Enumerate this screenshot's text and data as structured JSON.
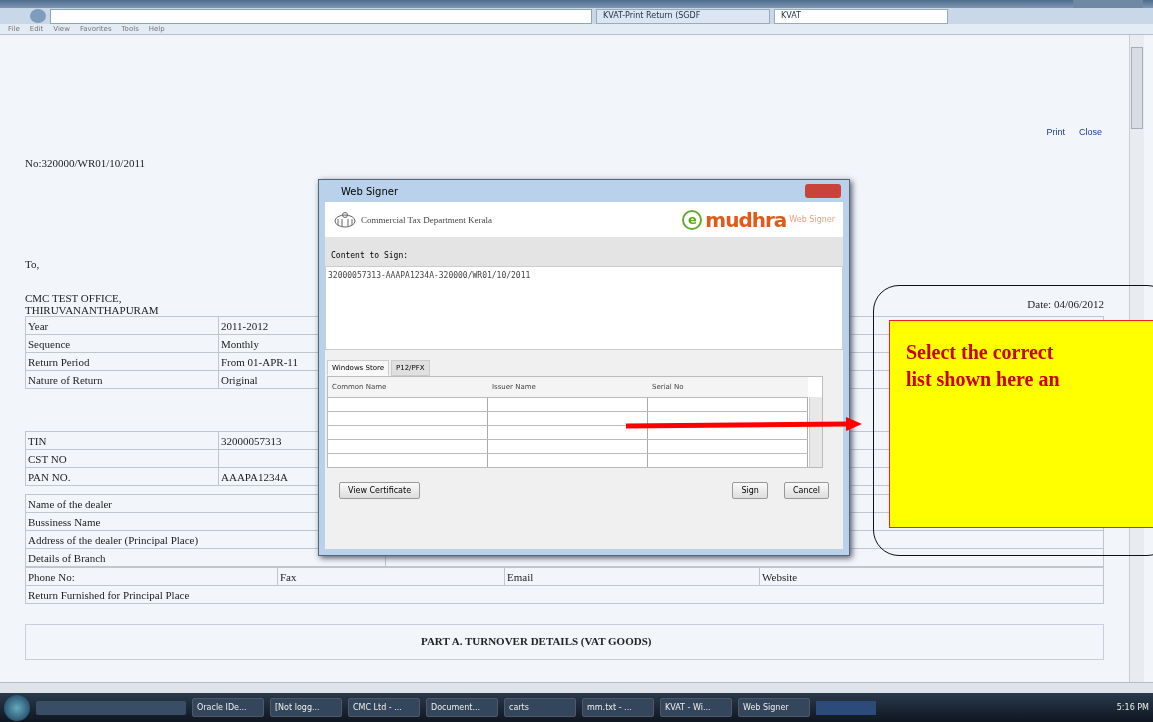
{
  "browser": {
    "tabs": [
      {
        "label": "KVAT-Print Return (SGDF",
        "selected": false
      },
      {
        "label": "KVAT",
        "selected": true
      }
    ],
    "menu": [
      "File",
      "Edit",
      "View",
      "Favorites",
      "Tools",
      "Help"
    ]
  },
  "document": {
    "links": [
      "Print",
      "Close"
    ],
    "number": "No:320000/WR01/10/2011",
    "to": "To,",
    "date": "Date: 04/06/2012",
    "address": [
      "CMC TEST OFFICE,",
      "THIRUVANANTHAPURAM"
    ],
    "return_table": [
      {
        "label": "Year",
        "value": "2011-2012"
      },
      {
        "label": "Sequence",
        "value": "Monthly"
      },
      {
        "label": "Return Period",
        "value": "From 01-APR-11"
      },
      {
        "label": "Nature of Return",
        "value": "Original"
      }
    ],
    "id_table": [
      {
        "label": "TIN",
        "value": "32000057313"
      },
      {
        "label": "CST NO"
      },
      {
        "label": "PAN NO.",
        "value": "AAAPA1234A"
      }
    ],
    "dealer_table": [
      "Name of the dealer",
      "Bussiness Name",
      "Address of the dealer (Principal Place)",
      "Details of Branch"
    ],
    "contact_row": [
      "Phone No:",
      "Fax",
      "Email",
      "Website"
    ],
    "furnished": "Return Furnished for Principal Place",
    "part_a": "PART A. TURNOVER DETAILS (VAT GOODS)"
  },
  "dialog": {
    "title": "Web Signer",
    "department": "Commercial Tax Department Kerala",
    "brand_mark": "e",
    "brand": "mudhra",
    "brand_product": "Web Signer",
    "content_label": "Content to Sign:",
    "content": "32000057313-AAAPA1234A-320000/WR01/10/2011",
    "tabs": [
      {
        "label": "Windows Store",
        "selected": true
      },
      {
        "label": "P12/PFX",
        "selected": false
      }
    ],
    "columns": [
      "Common Name",
      "Issuer Name",
      "Serial No"
    ],
    "buttons": {
      "view": "View Certificate",
      "sign": "Sign",
      "cancel": "Cancel"
    }
  },
  "callout": [
    "Select the correct",
    "list shown here an"
  ],
  "taskbar": {
    "items": [
      "Oracle IDe...",
      "[Not logg...",
      "CMC Ltd - ...",
      "Document...",
      "carts",
      "mm.txt - ...",
      "KVAT - Wi...",
      "Web Signer"
    ],
    "time": "5:16 PM"
  }
}
